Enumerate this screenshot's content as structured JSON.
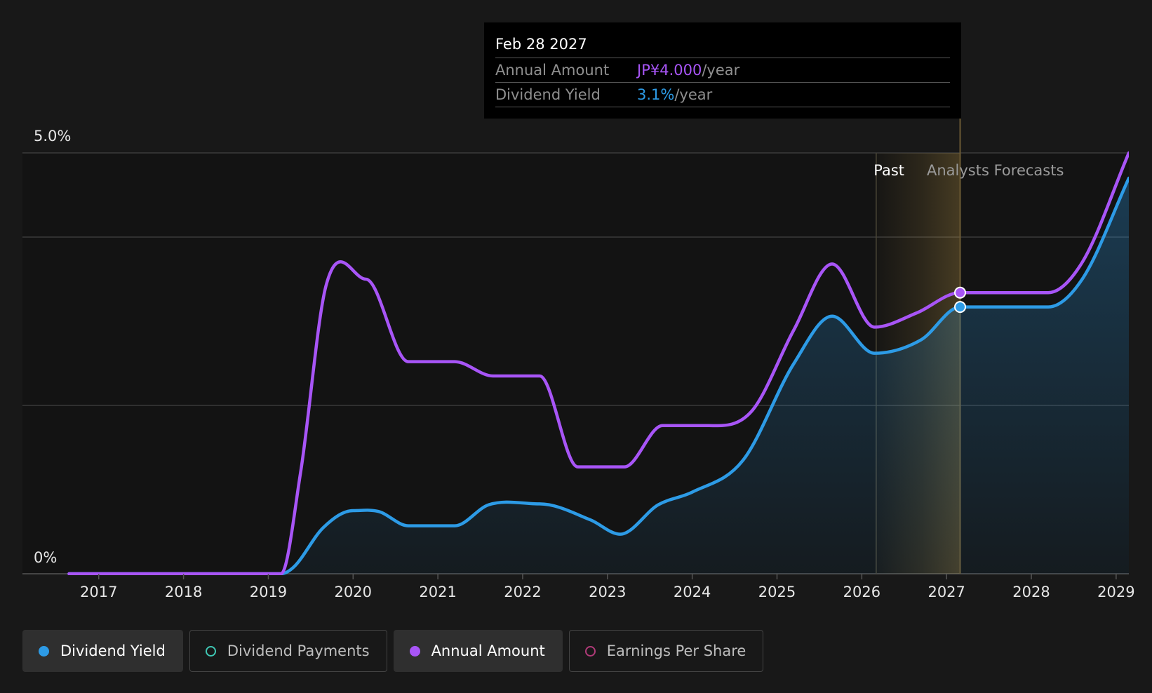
{
  "tooltip": {
    "date": "Feb 28 2027",
    "rows": [
      {
        "label": "Annual Amount",
        "value": "JP¥4.000",
        "unit": "/year",
        "color": "#a855f7"
      },
      {
        "label": "Dividend Yield",
        "value": "3.1%",
        "unit": "/year",
        "color": "#2d9be6"
      }
    ]
  },
  "chart_data": {
    "type": "line",
    "title": "",
    "xlabel": "",
    "ylabel": "",
    "y_tick_labels": [
      "5.0%",
      "0%"
    ],
    "x_tick_labels": [
      "2017",
      "2018",
      "2019",
      "2020",
      "2021",
      "2022",
      "2023",
      "2024",
      "2025",
      "2026",
      "2027",
      "2028",
      "2029"
    ],
    "xlim": [
      2016.1,
      2029.15
    ],
    "ylim": [
      0,
      5
    ],
    "grid": true,
    "region_labels": {
      "past": "Past",
      "forecast": "Analysts Forecasts"
    },
    "past_end": 2026.17,
    "tooltip_x": 2027.16,
    "series": [
      {
        "name": "Dividend Yield",
        "color": "#2d9be6",
        "points": [
          [
            2016.65,
            0
          ],
          [
            2019.15,
            0
          ],
          [
            2019.3,
            0.08
          ],
          [
            2019.65,
            0.55
          ],
          [
            2020.0,
            0.75
          ],
          [
            2020.3,
            0.74
          ],
          [
            2020.65,
            0.57
          ],
          [
            2021.2,
            0.57
          ],
          [
            2021.6,
            0.82
          ],
          [
            2022.2,
            0.83
          ],
          [
            2022.8,
            0.64
          ],
          [
            2023.15,
            0.47
          ],
          [
            2023.6,
            0.82
          ],
          [
            2024.0,
            0.97
          ],
          [
            2024.6,
            1.35
          ],
          [
            2025.2,
            2.5
          ],
          [
            2025.65,
            3.06
          ],
          [
            2026.15,
            2.62
          ],
          [
            2026.7,
            2.78
          ],
          [
            2027.16,
            3.17
          ],
          [
            2028.2,
            3.17
          ],
          [
            2028.6,
            3.5
          ],
          [
            2029.15,
            4.7
          ]
        ],
        "marker_at": 2027.16
      },
      {
        "name": "Annual Amount",
        "color": "#a855f7",
        "points": [
          [
            2016.65,
            0
          ],
          [
            2019.15,
            0
          ],
          [
            2019.38,
            1.2
          ],
          [
            2019.68,
            3.42
          ],
          [
            2020.15,
            3.5
          ],
          [
            2020.65,
            2.52
          ],
          [
            2021.2,
            2.52
          ],
          [
            2021.65,
            2.35
          ],
          [
            2022.2,
            2.35
          ],
          [
            2022.65,
            1.27
          ],
          [
            2023.2,
            1.27
          ],
          [
            2023.65,
            1.76
          ],
          [
            2024.2,
            1.76
          ],
          [
            2024.7,
            1.93
          ],
          [
            2025.2,
            2.9
          ],
          [
            2025.65,
            3.68
          ],
          [
            2026.15,
            2.93
          ],
          [
            2026.65,
            3.1
          ],
          [
            2027.16,
            3.34
          ],
          [
            2028.2,
            3.34
          ],
          [
            2028.6,
            3.7
          ],
          [
            2029.15,
            5.0
          ]
        ],
        "marker_at": 2027.16
      }
    ]
  },
  "legend": [
    {
      "label": "Dividend Yield",
      "color": "#2d9be6",
      "filled": true,
      "active": true
    },
    {
      "label": "Dividend Payments",
      "color": "#3fc7b4",
      "filled": false,
      "active": false
    },
    {
      "label": "Annual Amount",
      "color": "#a855f7",
      "filled": true,
      "active": true
    },
    {
      "label": "Earnings Per Share",
      "color": "#b03a78",
      "filled": false,
      "active": false
    }
  ]
}
